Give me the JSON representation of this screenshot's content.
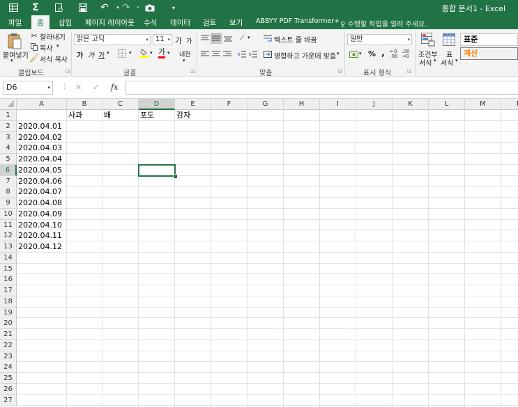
{
  "window": {
    "title": "통합 문서1 - Excel"
  },
  "qat": {
    "autosave_icon": "table-icon",
    "sum_icon": "sigma-icon",
    "sign": "Σ",
    "undo": "↶",
    "redo": "↷",
    "more": "▾"
  },
  "menu": {
    "tabs": [
      "파일",
      "홈",
      "삽입",
      "페이지 레이아웃",
      "수식",
      "데이터",
      "검토",
      "보기",
      "ABBYY PDF Transformer+"
    ],
    "active_index": 1,
    "tell_me": "수행할 작업을 알려 주세요."
  },
  "ribbon": {
    "clipboard": {
      "paste": "붙여넣기",
      "cut": "잘라내기",
      "copy": "복사",
      "format_painter": "서식 복사",
      "label": "클립보드"
    },
    "font": {
      "name": "맑은 고딕",
      "size": "11",
      "grow": "가",
      "shrink": "가",
      "bold": "가",
      "italic": "가",
      "underline": "가",
      "font_color_glyph": "가",
      "phonetic": "내천",
      "label": "글꼴",
      "fill_color": "#ffff00",
      "text_color": "#ff0000"
    },
    "alignment": {
      "wrap_text": "텍스트 줄 바꿈",
      "merge_center": "병합하고 가운데 맞춤",
      "label": "맞춤"
    },
    "number": {
      "format": "일반",
      "percent": "%",
      "comma": ",",
      "label": "표시 형식"
    },
    "styles": {
      "conditional": "조건부",
      "conditional2": "서식",
      "table": "표",
      "table2": "서식",
      "normal": "표준",
      "calc": "계산"
    }
  },
  "formula_bar": {
    "name_box": "D6",
    "cancel": "✕",
    "enter": "✓",
    "fx": "fx",
    "content": ""
  },
  "sheet": {
    "columns": [
      "A",
      "B",
      "C",
      "D",
      "E",
      "F",
      "G",
      "H",
      "I",
      "J",
      "K",
      "L",
      "M",
      "N"
    ],
    "selected_col": "D",
    "selected_row": 6,
    "rows": 27,
    "header_row": {
      "B": "사과",
      "C": "배",
      "D": "포도",
      "E": "감자"
    },
    "dates": [
      "2020.04.01",
      "2020.04.02",
      "2020.04.03",
      "2020.04.04",
      "2020.04.05",
      "2020.04.06",
      "2020.04.07",
      "2020.04.08",
      "2020.04.09",
      "2020.04.10",
      "2020.04.11",
      "2020.04.12"
    ]
  },
  "colors": {
    "excel_green": "#217346"
  }
}
